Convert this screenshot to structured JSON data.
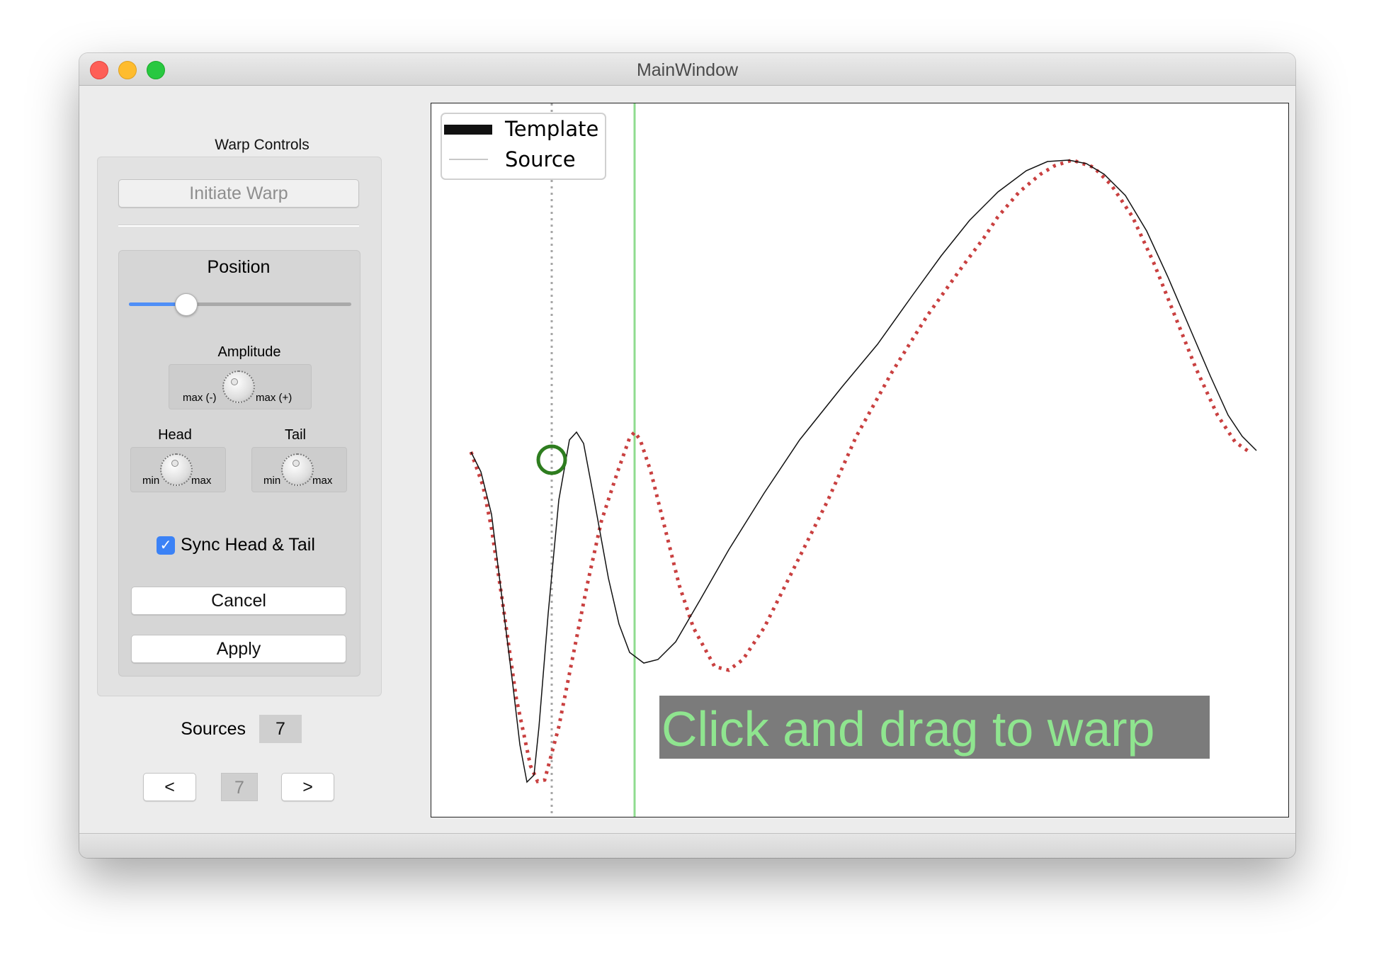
{
  "window": {
    "title": "MainWindow"
  },
  "controls": {
    "group_title": "Warp Controls",
    "initiate_warp_label": "Initiate Warp",
    "position_label": "Position",
    "position_value": 0.26,
    "amplitude_label": "Amplitude",
    "amplitude_min_label": "max (-)",
    "amplitude_max_label": "max (+)",
    "head_label": "Head",
    "tail_label": "Tail",
    "dial_min_label": "min",
    "dial_max_label": "max",
    "sync_label": "Sync Head & Tail",
    "sync_checked": true,
    "checkmark": "✓",
    "cancel_label": "Cancel",
    "apply_label": "Apply"
  },
  "sources": {
    "label": "Sources",
    "count": "7",
    "prev_label": "<",
    "current": "7",
    "next_label": ">"
  },
  "plot": {
    "legend": [
      "Template",
      "Source"
    ],
    "overlay_text": "Click and drag to warp",
    "colors": {
      "template": "#111111",
      "source": "#c94040",
      "cursor_line": "#8fdc8f",
      "marker": "#2e7d1f",
      "overlay_bg": "#7b7b7b",
      "overlay_text": "#8fe58f"
    }
  }
}
